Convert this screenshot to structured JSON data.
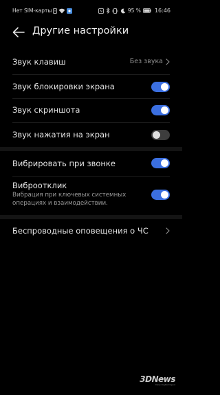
{
  "status_bar": {
    "carrier": "Нет SIM-карты",
    "battery": "95 %",
    "time": "16:46"
  },
  "header": {
    "title": "Другие настройки"
  },
  "settings": {
    "key_sound": {
      "label": "Звук клавиш",
      "value": "Без звука"
    },
    "lock_sound": {
      "label": "Звук блокировки экрана",
      "enabled": true
    },
    "screenshot_sound": {
      "label": "Звук скриншота",
      "enabled": true
    },
    "touch_sound": {
      "label": "Звук нажатия на экран",
      "enabled": false
    },
    "vibrate_on_ring": {
      "label": "Вибрировать при звонке",
      "enabled": true
    },
    "haptic_feedback": {
      "label": "Виброотклик",
      "description": "Вибрация при ключевых системных операциях и взаимодействии.",
      "enabled": true
    },
    "emergency_alerts": {
      "label": "Беспроводные оповещения о ЧС"
    }
  },
  "watermark": {
    "logo": "3DNews",
    "tagline": "Daily Digital Digest"
  },
  "colors": {
    "background": "#000000",
    "toggle_on": "#3b6fe0",
    "toggle_off": "#3d3d3d"
  }
}
